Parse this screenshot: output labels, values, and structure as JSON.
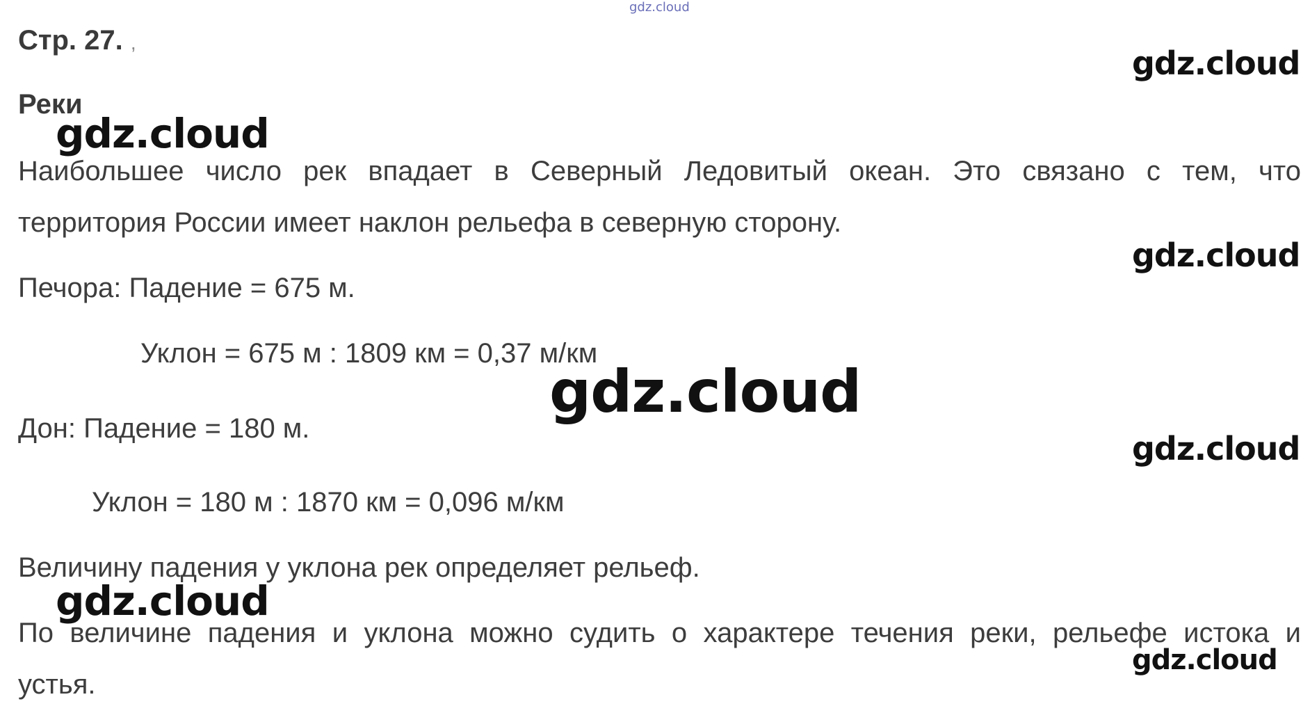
{
  "header": {
    "site_mark": "gdz.cloud",
    "page_label": "Стр. 27.",
    "page_label_trailing": ","
  },
  "section": {
    "title": "Реки"
  },
  "content": {
    "intro_line1": "Наибольшее число рек впадает в Северный Ледовитый океан. Это связано с тем, что",
    "intro_line2": "территория России имеет наклон рельефа в северную сторону.",
    "pechora_fall": "Печора: Падение = 675 м.",
    "pechora_slope": "Уклон = 675 м : 1809 км = 0,37 м/км",
    "don_fall": "Дон: Падение = 180 м.",
    "don_slope": "Уклон = 180 м : 1870 км = 0,096 м/км",
    "relief_statement": "Величину падения у уклона рек определяет рельеф.",
    "conclusion_line1": "По величине падения и уклона можно судить о характере течения реки, рельефе истока и",
    "conclusion_line2": "устья."
  },
  "watermarks": {
    "text": "gdz.cloud"
  },
  "colors": {
    "text": "#3d3d3d",
    "watermark": "#111111",
    "site_mark": "#6a6fb8",
    "background": "#ffffff"
  }
}
